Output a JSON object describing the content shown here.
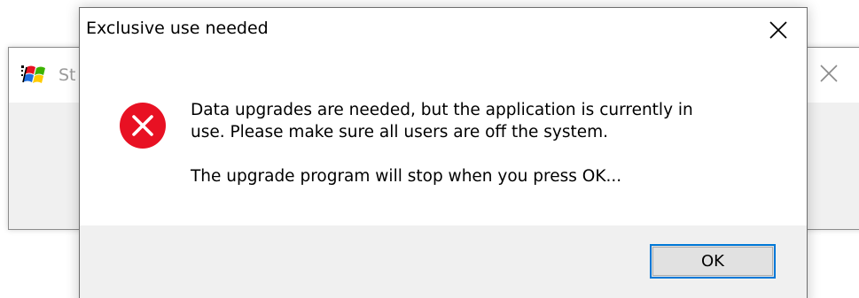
{
  "background_window": {
    "title": "St",
    "app_icon": "windows-flag-icon",
    "close_icon": "close-icon"
  },
  "dialog": {
    "title": "Exclusive use needed",
    "close_icon": "close-icon",
    "error_icon": "error-icon",
    "error_color": "#e81123",
    "message_lines": [
      "Data upgrades are needed, but the application is currently in",
      "use.  Please make sure all users are off the system."
    ],
    "message_second": "The upgrade program will stop when you press OK...",
    "ok_label": "OK",
    "accent_color": "#0078d7"
  }
}
